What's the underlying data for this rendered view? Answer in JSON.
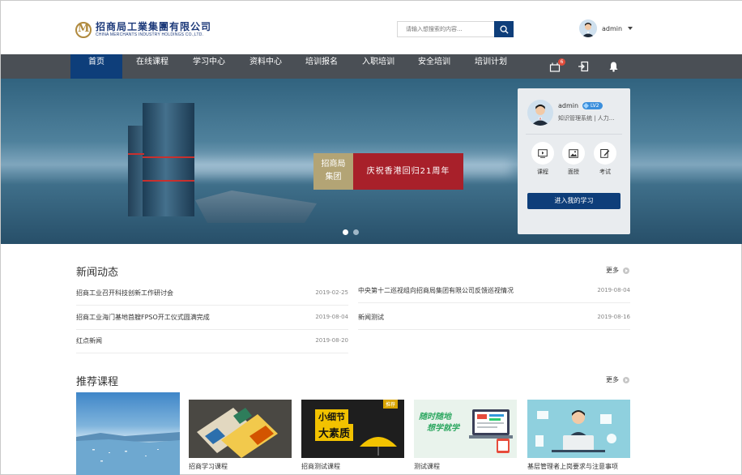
{
  "header": {
    "logo_cn": "招商局工業集團有限公司",
    "logo_en": "CHINA MERCHANTS INDUSTRY HOLDINGS CO.,LTD.",
    "search_placeholder": "请输入想搜索的内容...",
    "user_name": "admin"
  },
  "nav": {
    "items": [
      {
        "label": "首页",
        "active": true
      },
      {
        "label": "在线课程"
      },
      {
        "label": "学习中心"
      },
      {
        "label": "资料中心"
      },
      {
        "label": "培训报名"
      },
      {
        "label": "入职培训"
      },
      {
        "label": "安全培训"
      },
      {
        "label": "培训计划"
      }
    ],
    "cart_count": "6",
    "icons": [
      "cart-icon",
      "logout-icon",
      "bell-icon"
    ]
  },
  "banner": {
    "tag_line1": "招商局",
    "tag_line2": "集团",
    "caption": "庆祝香港回归21周年",
    "slides_total": 2,
    "slide_active": 1
  },
  "panel": {
    "name": "admin",
    "level": "LV2",
    "role": "知识管理系统 | 人力...",
    "quick_links": [
      {
        "label": "课程",
        "icon": "play-icon"
      },
      {
        "label": "面授",
        "icon": "picture-icon"
      },
      {
        "label": "考试",
        "icon": "edit-icon"
      }
    ],
    "enter_label": "进入我的学习"
  },
  "news": {
    "title": "新闻动态",
    "more": "更多",
    "items": [
      {
        "title": "招商工业召开科技创新工作研讨会",
        "date": "2019-02-25"
      },
      {
        "title": "中央第十二巡视组向招商局集团有限公司反馈巡视情况",
        "date": "2019-08-04"
      },
      {
        "title": "招商工业海门基地首艘FPSO开工仪式圆满完成",
        "date": "2019-08-04"
      },
      {
        "title": "新闻测试",
        "date": "2019-08-16"
      },
      {
        "title": "红点新闻",
        "date": "2019-08-20"
      }
    ]
  },
  "courses": {
    "title": "推荐课程",
    "more": "更多",
    "items": [
      {
        "title": "招商学习课程"
      },
      {
        "title": "招商测试课程",
        "thumb_line1": "小细节",
        "thumb_line2": "大素质",
        "thumb_badge": "推荐"
      },
      {
        "title": "测试课程",
        "thumb_line1": "随时随地",
        "thumb_line2": "想学就学"
      },
      {
        "title": "基层管理者上岗要求与注意事项"
      }
    ]
  },
  "colors": {
    "brand_blue": "#0e3e7a",
    "nav_bg": "#4a4f55",
    "caption_red": "#a8202a",
    "tag_gold": "#b3a475"
  }
}
